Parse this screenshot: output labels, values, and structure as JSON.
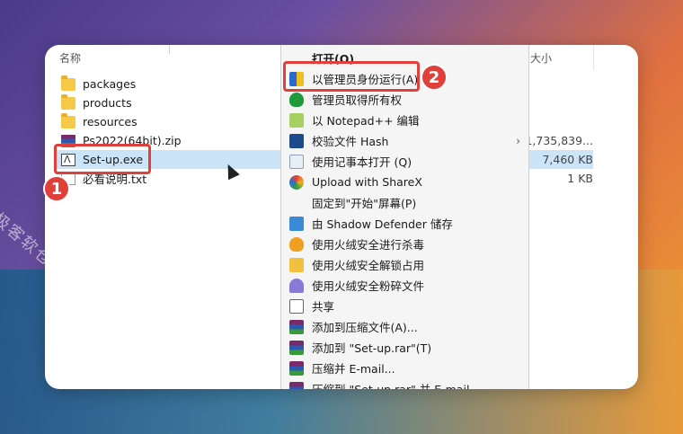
{
  "explorer": {
    "header_name": "名称",
    "header_size": "大小",
    "files": [
      {
        "name": "packages",
        "type": "folder",
        "size": ""
      },
      {
        "name": "products",
        "type": "folder",
        "size": ""
      },
      {
        "name": "resources",
        "type": "folder",
        "size": ""
      },
      {
        "name": "Ps2022(64bit).zip",
        "type": "zip",
        "size": "1,735,839..."
      },
      {
        "name": "Set-up.exe",
        "type": "exe",
        "size": "7,460 KB"
      },
      {
        "name": "必看说明.txt",
        "type": "txt",
        "size": "1 KB"
      }
    ]
  },
  "context_menu": {
    "items": [
      {
        "label": "打开(O)",
        "icon": "none"
      },
      {
        "label": "以管理员身份运行(A)",
        "icon": "shield-icon"
      },
      {
        "label": "管理员取得所有权",
        "icon": "green-shield-icon"
      },
      {
        "label": "以 Notepad++ 编辑",
        "icon": "notepadpp-icon"
      },
      {
        "label": "校验文件 Hash",
        "icon": "powershell-icon",
        "submenu": true
      },
      {
        "label": "使用记事本打开 (Q)",
        "icon": "notepad-icon"
      },
      {
        "label": "Upload with ShareX",
        "icon": "sharex-icon"
      },
      {
        "label": "固定到\"开始\"屏幕(P)",
        "icon": "none"
      },
      {
        "label": "由 Shadow Defender 储存",
        "icon": "shadow-defender-icon"
      },
      {
        "label": "使用火绒安全进行杀毒",
        "icon": "huorong-icon"
      },
      {
        "label": "使用火绒安全解锁占用",
        "icon": "folder-lock-icon"
      },
      {
        "label": "使用火绒安全粉碎文件",
        "icon": "shred-icon"
      },
      {
        "label": "共享",
        "icon": "share-icon"
      },
      {
        "label": "添加到压缩文件(A)...",
        "icon": "winrar-icon"
      },
      {
        "label": "添加到 \"Set-up.rar\"(T)",
        "icon": "winrar-icon"
      },
      {
        "label": "压缩并 E-mail...",
        "icon": "winrar-icon"
      },
      {
        "label": "压缩到 \"Set-up.rar\" 并 E-mail",
        "icon": "winrar-icon"
      }
    ]
  },
  "annotations": {
    "badge_1": "1",
    "badge_2": "2",
    "watermark": "极客软仓"
  },
  "colors": {
    "highlight": "#e0403a",
    "selection": "#cce4f7",
    "menu_bg": "#f5f5f5"
  }
}
